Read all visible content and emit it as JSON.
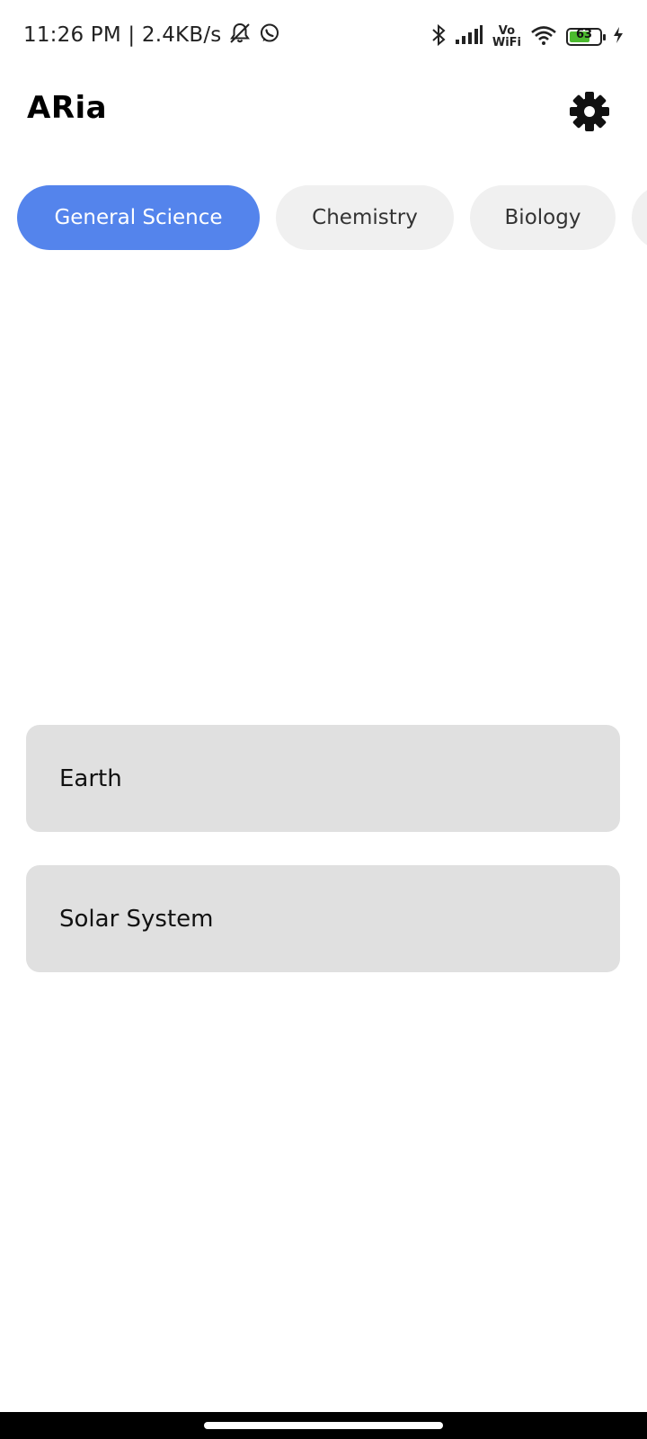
{
  "status_bar": {
    "time_speed": "11:26 PM | 2.4KB/s",
    "vowifi_top": "Vo",
    "vowifi_bottom": "WiFi",
    "battery_level": "63",
    "icons": [
      "notifications-off-icon",
      "whatsapp-icon",
      "bluetooth-icon",
      "cellular-signal-icon",
      "wifi-icon",
      "battery-icon",
      "charging-icon"
    ]
  },
  "header": {
    "title": "ARia",
    "settings_icon": "gear-icon"
  },
  "tabs": [
    {
      "label": "General Science",
      "active": true
    },
    {
      "label": "Chemistry",
      "active": false
    },
    {
      "label": "Biology",
      "active": false
    },
    {
      "label": "",
      "active": false
    }
  ],
  "topics": [
    {
      "label": "Earth"
    },
    {
      "label": "Solar System"
    }
  ],
  "colors": {
    "accent": "#5484ec",
    "tab_inactive": "#f0f0f0",
    "card_background": "#e0e0e0",
    "battery_fill": "#4cbb2f"
  }
}
